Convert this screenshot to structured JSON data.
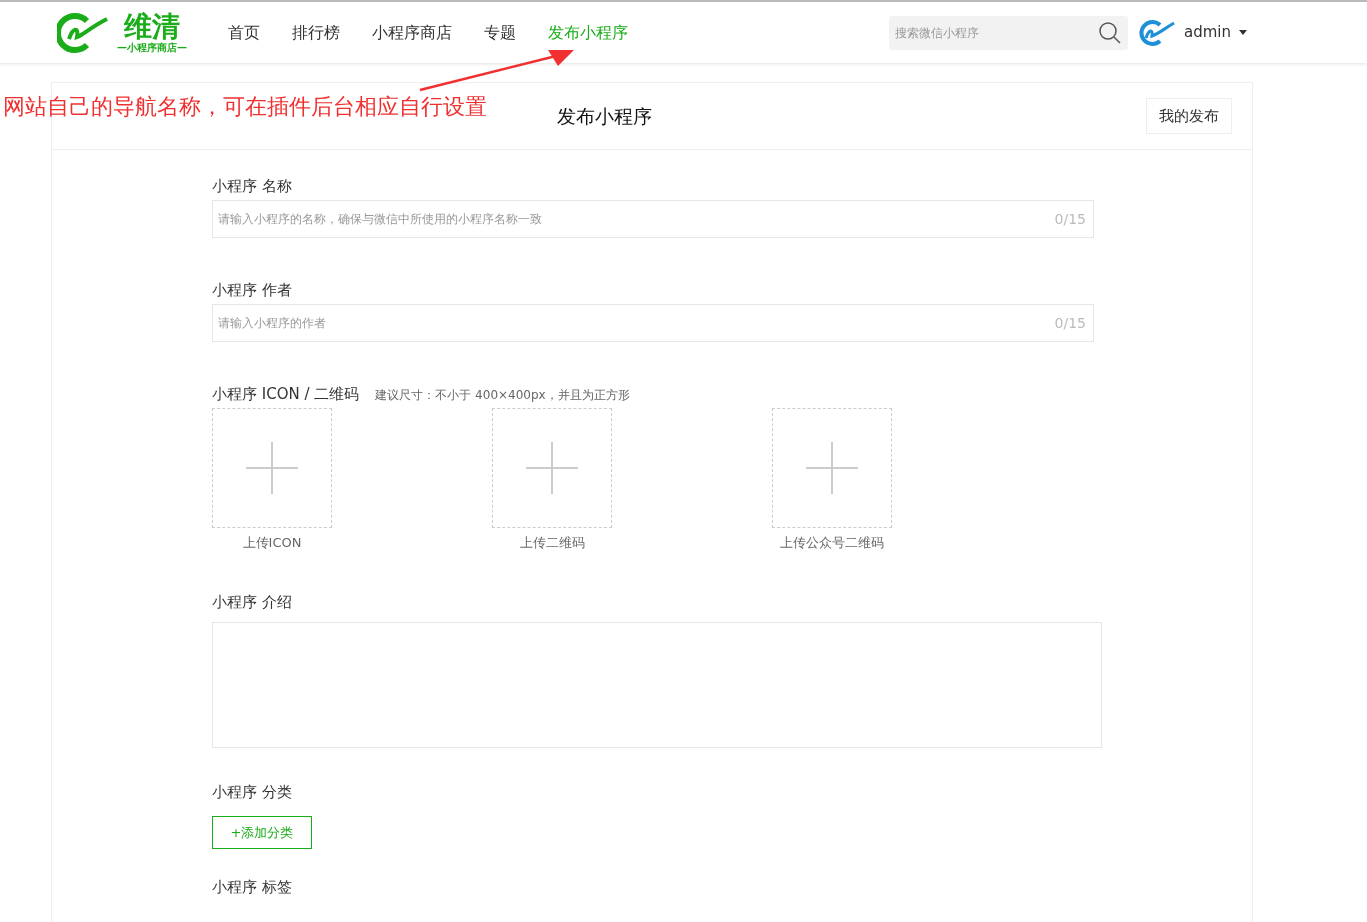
{
  "header": {
    "logo": {
      "name": "维清",
      "tagline": "—小程序商店—"
    },
    "nav": [
      {
        "label": "首页",
        "selected": false
      },
      {
        "label": "排行榜",
        "selected": false
      },
      {
        "label": "小程序商店",
        "selected": false
      },
      {
        "label": "专题",
        "selected": false
      },
      {
        "label": "发布小程序",
        "selected": true
      }
    ],
    "search": {
      "placeholder": "搜索微信小程序"
    },
    "user": {
      "name": "admin"
    }
  },
  "annotation": {
    "text": "网站自己的导航名称，可在插件后台相应自行设置"
  },
  "card": {
    "title": "发布小程序",
    "action": "我的发布",
    "fields": [
      {
        "kind": "text",
        "label": "小程序 名称",
        "placeholder": "请输入小程序的名称，确保与微信中所使用的小程序名称一致",
        "counter": "0/15"
      },
      {
        "kind": "text",
        "label": "小程序 作者",
        "placeholder": "请输入小程序的作者",
        "counter": "0/15"
      },
      {
        "kind": "upload",
        "label": "小程序 ICON / 二维码",
        "hint": "建议尺寸：不小于 400×400px，并且为正方形",
        "slots": [
          "上传ICON",
          "上传二维码",
          "上传公众号二维码"
        ]
      },
      {
        "kind": "textarea",
        "label": "小程序 介绍"
      },
      {
        "kind": "button",
        "label": "小程序 分类",
        "button": "+添加分类"
      },
      {
        "kind": "label",
        "label": "小程序 标签"
      }
    ]
  }
}
